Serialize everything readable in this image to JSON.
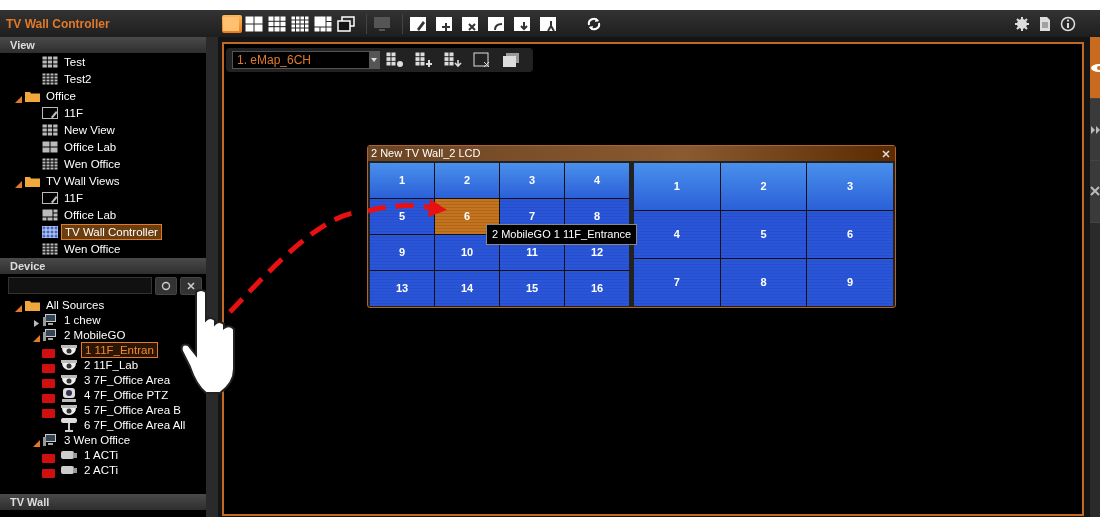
{
  "app": {
    "title": "TV Wall Controller"
  },
  "toolbar": {
    "layouts": [
      {
        "kind": "single",
        "selected": true
      },
      {
        "kind": "quad",
        "selected": false
      },
      {
        "kind": "nine",
        "selected": false
      },
      {
        "kind": "sixteen",
        "selected": false
      },
      {
        "kind": "mixed",
        "selected": false
      },
      {
        "kind": "popout",
        "selected": false
      }
    ]
  },
  "view_panel": {
    "header": "View",
    "items": [
      {
        "label": "Test",
        "kind": "grid3",
        "selected": false
      },
      {
        "label": "Test2",
        "kind": "grid4",
        "selected": false
      },
      {
        "label": "Office",
        "kind": "folder",
        "expanded": true,
        "selected": false,
        "children": [
          {
            "label": "11F",
            "kind": "emap",
            "selected": false
          },
          {
            "label": "New View",
            "kind": "grid3",
            "selected": false
          },
          {
            "label": "Office Lab",
            "kind": "grid2",
            "selected": false
          },
          {
            "label": "Wen Office",
            "kind": "grid4",
            "selected": false
          }
        ]
      },
      {
        "label": "TV Wall Views",
        "kind": "folder",
        "expanded": true,
        "selected": false,
        "children": [
          {
            "label": "11F",
            "kind": "emap",
            "selected": false
          },
          {
            "label": "Office Lab",
            "kind": "mixed",
            "selected": false
          },
          {
            "label": "TV Wall Controller",
            "kind": "tvwall",
            "selected": true
          },
          {
            "label": "Wen Office",
            "kind": "grid4",
            "selected": false
          }
        ]
      }
    ]
  },
  "device_panel": {
    "header": "Device",
    "items": [
      {
        "label": "All Sources",
        "kind": "folder",
        "expanded": true,
        "selected": false,
        "children": [
          {
            "label": "1 chew",
            "kind": "server",
            "expanded": false,
            "selected": false
          },
          {
            "label": "2 MobileGO",
            "kind": "server",
            "expanded": true,
            "selected": false,
            "children": [
              {
                "label": "1 11F_Entran",
                "kind": "dome",
                "recording": true,
                "selected": true
              },
              {
                "label": "2 11F_Lab",
                "kind": "dome",
                "recording": true,
                "selected": false
              },
              {
                "label": "3 7F_Office Area",
                "kind": "dome",
                "recording": true,
                "selected": false
              },
              {
                "label": "4 7F_Office PTZ",
                "kind": "ptz",
                "recording": true,
                "selected": false
              },
              {
                "label": "5 7F_Office Area B",
                "kind": "dome",
                "recording": true,
                "selected": false
              },
              {
                "label": "6 7F_Office Area All",
                "kind": "bullet",
                "recording": false,
                "selected": false
              }
            ]
          },
          {
            "label": "3 Wen Office",
            "kind": "server",
            "expanded": true,
            "selected": false,
            "children": [
              {
                "label": "1 ACTi",
                "kind": "box",
                "recording": true,
                "selected": false
              },
              {
                "label": "2 ACTi",
                "kind": "box",
                "recording": true,
                "selected": false
              }
            ]
          }
        ]
      }
    ]
  },
  "tv_wall_panel": {
    "header": "TV Wall"
  },
  "map_bar": {
    "selected_map": "1. eMap_6CH"
  },
  "wall_window": {
    "title": "2 New TV Wall_2 LCD",
    "tooltip": "2 MobileGO 1 11F_Entrance",
    "monitors": [
      {
        "cells": [
          {
            "label": "1",
            "selected": false
          },
          {
            "label": "2",
            "selected": false
          },
          {
            "label": "3",
            "selected": false
          },
          {
            "label": "4",
            "selected": false
          },
          {
            "label": "5",
            "selected": false
          },
          {
            "label": "6",
            "selected": true
          },
          {
            "label": "7",
            "selected": false
          },
          {
            "label": "8",
            "selected": false
          },
          {
            "label": "9",
            "selected": false
          },
          {
            "label": "10",
            "selected": false
          },
          {
            "label": "11",
            "selected": false
          },
          {
            "label": "12",
            "selected": false
          },
          {
            "label": "13",
            "selected": false
          },
          {
            "label": "14",
            "selected": false
          },
          {
            "label": "15",
            "selected": false
          },
          {
            "label": "16",
            "selected": false
          }
        ]
      },
      {
        "cells": [
          {
            "label": "1",
            "selected": false
          },
          {
            "label": "2",
            "selected": false
          },
          {
            "label": "3",
            "selected": false
          },
          {
            "label": "4",
            "selected": false
          },
          {
            "label": "5",
            "selected": false
          },
          {
            "label": "6",
            "selected": false
          },
          {
            "label": "7",
            "selected": false
          },
          {
            "label": "8",
            "selected": false
          },
          {
            "label": "9",
            "selected": false
          }
        ]
      }
    ]
  },
  "side_tabs": [
    {
      "kind": "eye",
      "selected": true
    },
    {
      "kind": "play",
      "selected": false
    },
    {
      "kind": "tools",
      "selected": false
    }
  ]
}
